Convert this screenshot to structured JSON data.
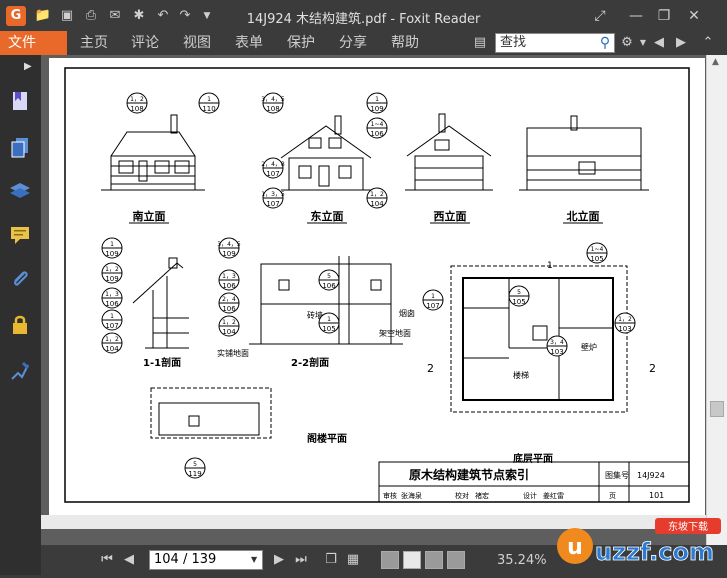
{
  "titlebar": {
    "title": "14J924 木结构建筑.pdf - Foxit Reader",
    "app_logo": "G",
    "quick_access": [
      "folder-icon",
      "save-icon",
      "print-icon",
      "email-icon",
      "new-icon",
      "undo-icon",
      "redo-icon",
      "customize-icon"
    ]
  },
  "ribbon": {
    "file_tab": "文件",
    "menus": [
      "主页",
      "评论",
      "视图",
      "表单",
      "保护",
      "分享",
      "帮助"
    ],
    "search_placeholder": "查找",
    "right_icons": [
      "settings-icon",
      "back-icon",
      "forward-icon",
      "collapse-icon"
    ]
  },
  "sidebar": {
    "icons": [
      "bookmark-icon",
      "pages-icon",
      "layers-icon",
      "comments-icon",
      "attachments-icon",
      "security-icon",
      "signature-icon"
    ]
  },
  "drawing": {
    "views": [
      "南立面",
      "东立面",
      "西立面",
      "北立面",
      "1-1剖面",
      "2-2剖面",
      "阁楼平面",
      "底层平面"
    ],
    "labels": {
      "chimney": "烟囱",
      "stove": "壁炉",
      "raised_floor": "架空地面",
      "solid_floor": "实铺地面",
      "stove_wall": "砖墙",
      "stairs": "楼梯"
    },
    "section_mark": "2",
    "section_mark_1": "1",
    "titleblock": {
      "title": "原木结构建筑节点索引",
      "atlas_label": "图集号",
      "atlas_no": "14J924",
      "page_label": "页",
      "page_no": "101",
      "review": "审核",
      "review_name": "张海泉",
      "check": "校对",
      "check_name": "褚宏",
      "design": "设计",
      "design_name": "姜红雷"
    },
    "callouts": [
      {
        "top": "1，2",
        "bottom": "108"
      },
      {
        "top": "1",
        "bottom": "110"
      },
      {
        "top": "3，4，5",
        "bottom": "108"
      },
      {
        "top": "1",
        "bottom": "109"
      },
      {
        "top": "1~4",
        "bottom": "106"
      },
      {
        "top": "2，4，8",
        "bottom": "107"
      },
      {
        "top": "1，3，5",
        "bottom": "107"
      },
      {
        "top": "1，2",
        "bottom": "104"
      },
      {
        "top": "1",
        "bottom": "109"
      },
      {
        "top": "1，2",
        "bottom": "109"
      },
      {
        "top": "1，3",
        "bottom": "106"
      },
      {
        "top": "1",
        "bottom": "107"
      },
      {
        "top": "1，2",
        "bottom": "104"
      },
      {
        "top": "3，4，5",
        "bottom": "109"
      },
      {
        "top": "1，3",
        "bottom": "106"
      },
      {
        "top": "2，4",
        "bottom": "106"
      },
      {
        "top": "1，2",
        "bottom": "104"
      },
      {
        "top": "5",
        "bottom": "106"
      },
      {
        "top": "1",
        "bottom": "105"
      },
      {
        "top": "1~4",
        "bottom": "105"
      },
      {
        "top": "1",
        "bottom": "107"
      },
      {
        "top": "5",
        "bottom": "105"
      },
      {
        "top": "1，2",
        "bottom": "103"
      },
      {
        "top": "3，4",
        "bottom": "103"
      },
      {
        "top": "5",
        "bottom": "119"
      }
    ]
  },
  "statusbar": {
    "page_value": "104 / 139",
    "zoom": "35.24%",
    "nav": [
      "first-page-icon",
      "prev-page-icon",
      "next-page-icon",
      "last-page-icon"
    ]
  },
  "watermark": {
    "text": "uzzf.com",
    "tag": "东坡下载"
  }
}
